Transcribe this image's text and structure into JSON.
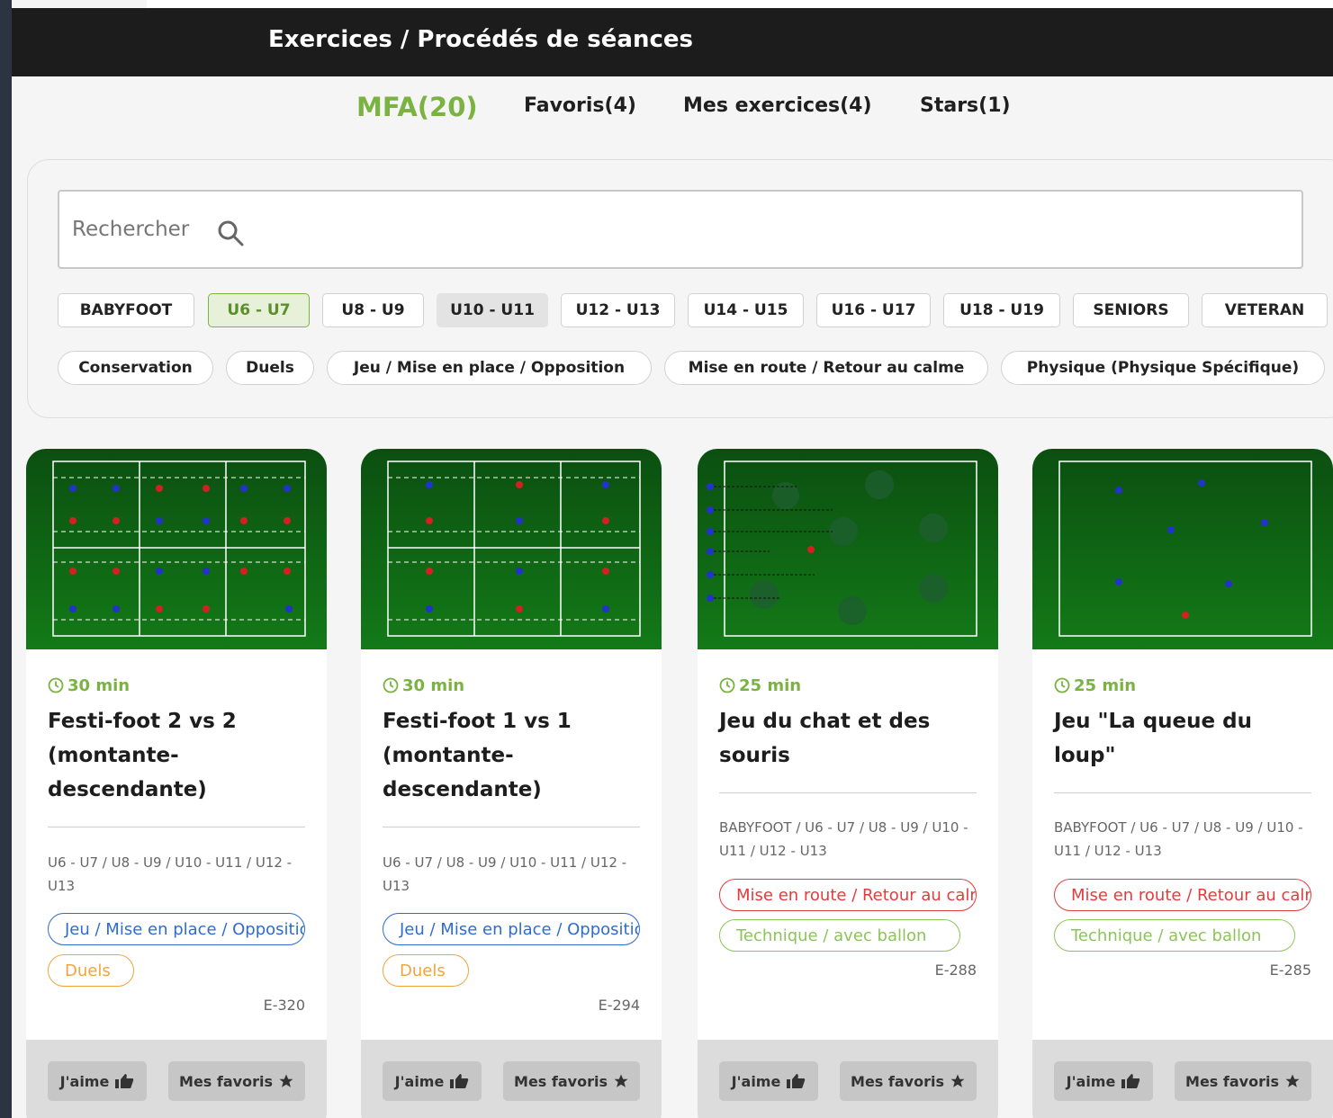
{
  "header": {
    "title": "Exercices / Procédés de séances"
  },
  "tabs": [
    {
      "label": "MFA(20)"
    },
    {
      "label": "Favoris(4)"
    },
    {
      "label": "Mes exercices(4)"
    },
    {
      "label": "Stars(1)"
    }
  ],
  "search": {
    "placeholder": "Rechercher"
  },
  "categories": [
    "BABYFOOT",
    "U6 - U7",
    "U8 - U9",
    "U10 - U11",
    "U12 - U13",
    "U14 - U15",
    "U16 - U17",
    "U18 - U19",
    "SENIORS",
    "VETERAN"
  ],
  "themes": [
    "Conservation",
    "Duels",
    "Jeu / Mise en place / Opposition",
    "Mise en route / Retour au calme",
    "Physique (Physique Spécifique)"
  ],
  "cards": [
    {
      "duration": "30 min",
      "title": "Festi-foot 2 vs 2 (montante-descendante)",
      "levels": "U6 - U7 / U8 - U9 / U10 - U11 / U12 - U13",
      "tags": [
        "Jeu / Mise en place / Opposition",
        "Duels"
      ],
      "code": "E-320",
      "like": "J'aime",
      "fav": "Mes favoris"
    },
    {
      "duration": "30 min",
      "title": "Festi-foot 1 vs 1 (montante-descendante)",
      "levels": "U6 - U7 / U8 - U9 / U10 - U11 / U12 - U13",
      "tags": [
        "Jeu / Mise en place / Opposition",
        "Duels"
      ],
      "code": "E-294",
      "like": "J'aime",
      "fav": "Mes favoris"
    },
    {
      "duration": "25 min",
      "title": "Jeu du chat et des souris",
      "levels": "BABYFOOT / U6 - U7 / U8 - U9 / U10 - U11 / U12 - U13",
      "tags": [
        "Mise en route / Retour au calme",
        "Technique / avec ballon"
      ],
      "code": "E-288",
      "like": "J'aime",
      "fav": "Mes favoris"
    },
    {
      "duration": "25 min",
      "title": "Jeu \"La queue du loup\"",
      "levels": "BABYFOOT / U6 - U7 / U8 - U9 / U10 - U11 / U12 - U13",
      "tags": [
        "Mise en route / Retour au calme",
        "Technique / avec ballon"
      ],
      "code": "E-285",
      "like": "J'aime",
      "fav": "Mes favoris"
    }
  ],
  "colors": {
    "accent": "#7ab341",
    "header": "#1c1c1c",
    "pitch": "#137a18"
  }
}
